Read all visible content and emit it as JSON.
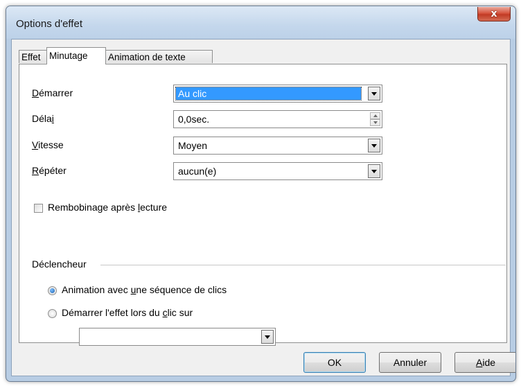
{
  "window": {
    "title": "Options d'effet",
    "close_glyph": "x"
  },
  "tabs": [
    {
      "label": "Effet",
      "active": false
    },
    {
      "label": "Minutage",
      "active": true
    },
    {
      "label": "Animation de texte",
      "active": false
    }
  ],
  "fields": {
    "start": {
      "label_pre": "",
      "label_u": "D",
      "label_post": "émarrer",
      "value": "Au clic"
    },
    "delay": {
      "label_pre": "Déla",
      "label_u": "i",
      "label_post": "",
      "value": "0,0sec."
    },
    "speed": {
      "label_pre": "",
      "label_u": "V",
      "label_post": "itesse",
      "value": "Moyen"
    },
    "repeat": {
      "label_pre": "",
      "label_u": "R",
      "label_post": "épéter",
      "value": "aucun(e)"
    }
  },
  "rewind": {
    "label_pre": "Rembobinage après ",
    "label_u": "l",
    "label_post": "ecture",
    "checked": false
  },
  "trigger": {
    "group_label": "Déclencheur",
    "option1": {
      "label_pre": "Animation avec ",
      "label_u": "u",
      "label_post": "ne séquence de clics",
      "selected": true
    },
    "option2": {
      "label_pre": "Démarrer l'effet lors du ",
      "label_u": "c",
      "label_post": "lic sur",
      "selected": false
    },
    "shape_value": ""
  },
  "buttons": {
    "ok": "OK",
    "cancel": "Annuler",
    "help_u": "A",
    "help_post": "ide"
  },
  "colors": {
    "selection": "#3399ff",
    "close_button": "#c13a24"
  }
}
